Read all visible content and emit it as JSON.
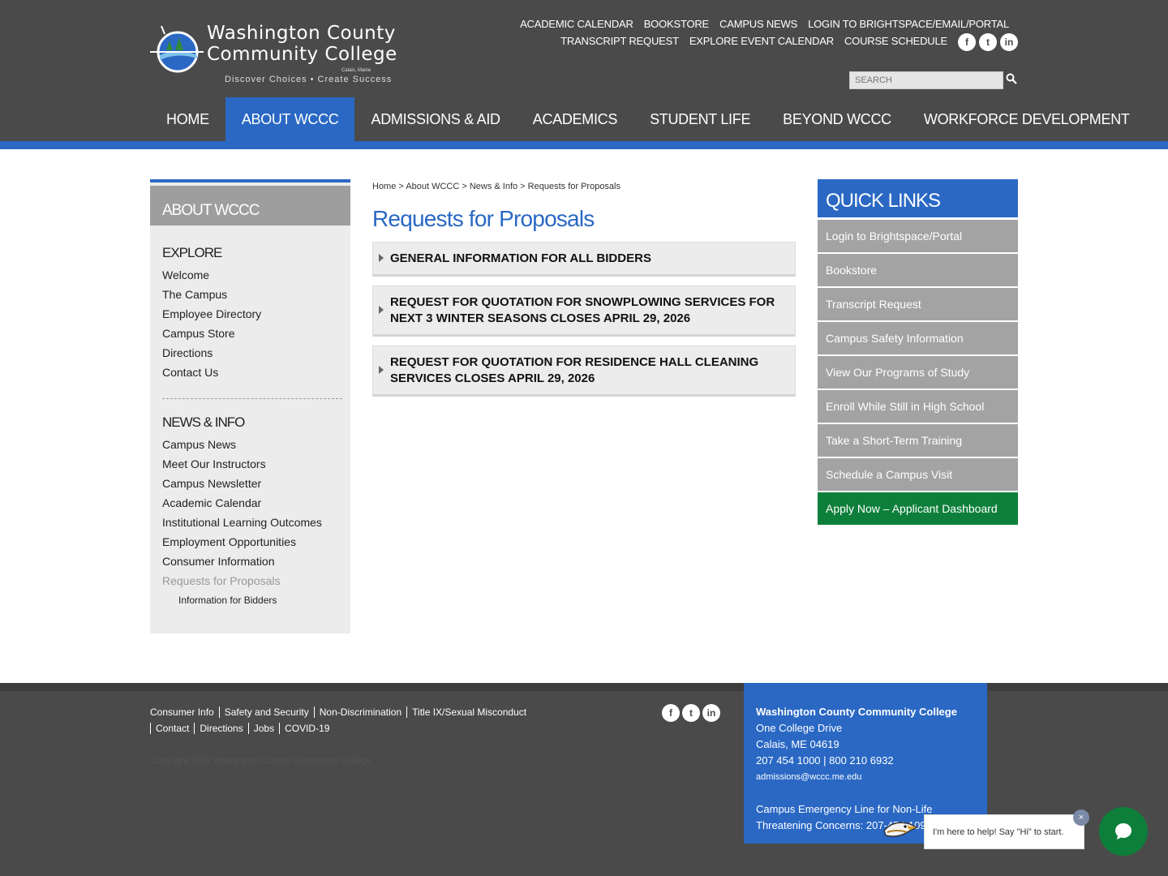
{
  "logo": {
    "line1": "Washington County",
    "line2": "Community College",
    "tagline": "Discover Choices • Create Success",
    "location": "Calais, Maine"
  },
  "utility": {
    "row1": [
      "ACADEMIC CALENDAR",
      "BOOKSTORE",
      "CAMPUS NEWS",
      "LOGIN TO BRIGHTSPACE/EMAIL/PORTAL"
    ],
    "row2": [
      "TRANSCRIPT REQUEST",
      "EXPLORE EVENT CALENDAR",
      "COURSE SCHEDULE"
    ]
  },
  "social": {
    "facebook": "f",
    "twitter": "t",
    "linkedin": "in"
  },
  "search": {
    "placeholder": "SEARCH"
  },
  "nav": [
    "HOME",
    "ABOUT WCCC",
    "ADMISSIONS & AID",
    "ACADEMICS",
    "STUDENT LIFE",
    "BEYOND WCCC",
    "WORKFORCE DEVELOPMENT"
  ],
  "sidebar": {
    "title": "ABOUT WCCC",
    "explore_heading": "EXPLORE",
    "explore": [
      "Welcome",
      "The Campus",
      "Employee Directory",
      "Campus Store",
      "Directions",
      "Contact Us"
    ],
    "news_heading": "NEWS & INFO",
    "news": [
      "Campus News",
      "Meet Our Instructors",
      "Campus Newsletter",
      "Academic Calendar",
      "Institutional Learning Outcomes",
      "Employment Opportunities",
      "Consumer Information",
      "Requests for Proposals"
    ],
    "sub": "Information for Bidders"
  },
  "breadcrumb": "Home > About WCCC > News & Info > Requests for Proposals",
  "page_title": "Requests for Proposals",
  "accordion": [
    "GENERAL INFORMATION FOR ALL BIDDERS",
    "REQUEST FOR QUOTATION FOR SNOWPLOWING SERVICES FOR NEXT 3 WINTER SEASONS CLOSES APRIL 29, 2026",
    "REQUEST FOR QUOTATION FOR RESIDENCE HALL CLEANING SERVICES CLOSES APRIL 29, 2026"
  ],
  "quick_links": {
    "title": "QUICK LINKS",
    "items": [
      "Login to Brightspace/Portal",
      "Bookstore",
      "Transcript Request",
      "Campus Safety Information",
      "View Our Programs of Study",
      "Enroll While Still in High School",
      "Take a Short-Term Training",
      "Schedule a Campus Visit",
      "Apply Now – Applicant Dashboard"
    ]
  },
  "footer": {
    "row1": [
      "Consumer Info",
      "Safety and Security",
      "Non-Discrimination",
      "Title IX/Sexual Misconduct"
    ],
    "row2": [
      "Contact",
      "Directions",
      "Jobs",
      "COVID-19"
    ],
    "copyright": "Copyright 2026 Washington County Community College",
    "contact": {
      "name": "Washington County Community College",
      "address1": "One College Drive",
      "address2": "Calais, ME 04619",
      "phone": "207 454 1000 | 800 210 6932",
      "email": "admissions@wccc.me.edu",
      "emergency1": "Campus Emergency Line for Non-Life",
      "emergency2": "Threatening Concerns: 207-454-1091"
    }
  },
  "chat": {
    "message": "I'm here to help! Say \"Hi\" to start.",
    "close": "×"
  },
  "colors": {
    "header": "#4a4a4a",
    "accent": "#2a68c4",
    "green": "#0d7f3a",
    "quicklink": "#a3a3a3"
  }
}
